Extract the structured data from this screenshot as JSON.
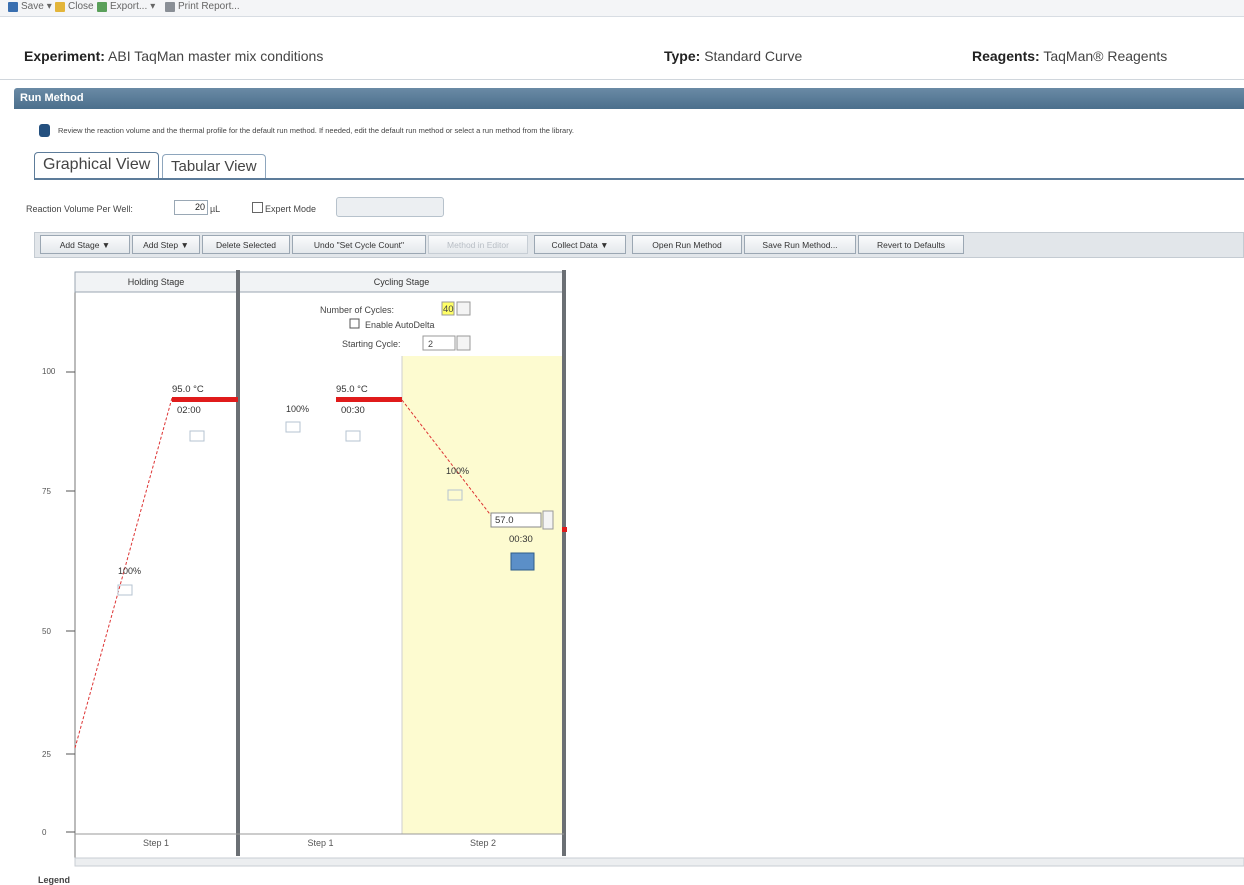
{
  "toolbar": {
    "save": "Save",
    "close": "Close",
    "export": "Export...",
    "print_report": "Print Report..."
  },
  "header": {
    "experiment_label": "Experiment:",
    "experiment_value": "ABI TaqMan master mix conditions",
    "type_label": "Type:",
    "type_value": "Standard Curve",
    "reagents_label": "Reagents:",
    "reagents_value": "TaqMan® Reagents"
  },
  "run_method": {
    "title": "Run Method",
    "info": "Review the reaction volume and the thermal profile for the default run method. If needed, edit the default run method or select a run method from the library."
  },
  "tabs": [
    {
      "label": "Graphical View",
      "active": true
    },
    {
      "label": "Tabular View",
      "active": false
    }
  ],
  "settings": {
    "reaction_volume_label": "Reaction Volume Per Well:",
    "reaction_volume_value": "20",
    "reaction_volume_unit": "µL",
    "expert_mode_label": "Expert Mode",
    "expert_mode_checked": false
  },
  "actions": {
    "add_stage": "Add Stage ▼",
    "add_step": "Add Step ▼",
    "delete_selected": "Delete Selected",
    "undo": "Undo \"Set Cycle Count\"",
    "disabled_action": "Method in Editor",
    "collect_data": "Collect Data ▼",
    "open_run_method": "Open Run Method",
    "save_run_method": "Save Run Method...",
    "revert_defaults": "Revert to Defaults"
  },
  "y_axis": {
    "ticks": [
      "100",
      "75",
      "50",
      "25",
      "0"
    ]
  },
  "stages": {
    "holding": {
      "title": "Holding Stage",
      "steps": [
        {
          "label": "Step 1",
          "temp": "95.0 °C",
          "time": "02:00",
          "ramp": "100%"
        }
      ]
    },
    "cycling": {
      "title": "Cycling Stage",
      "cycles_label": "Number of Cycles:",
      "cycles_value": "40",
      "autodelta_label": "Enable AutoDelta",
      "starting_cycle_label": "Starting Cycle:",
      "starting_cycle_value": "2",
      "steps": [
        {
          "label": "Step 1",
          "temp": "95.0 °C",
          "time": "00:30",
          "ramp": "100%"
        },
        {
          "label": "Step 2",
          "temp": "57.0",
          "time": "00:30",
          "ramp": "100%"
        }
      ]
    }
  },
  "colors": {
    "accent": "#4b6f8c",
    "hold": "#e01b1b",
    "selected_step": "#fdfbd0"
  },
  "legend": "Legend"
}
